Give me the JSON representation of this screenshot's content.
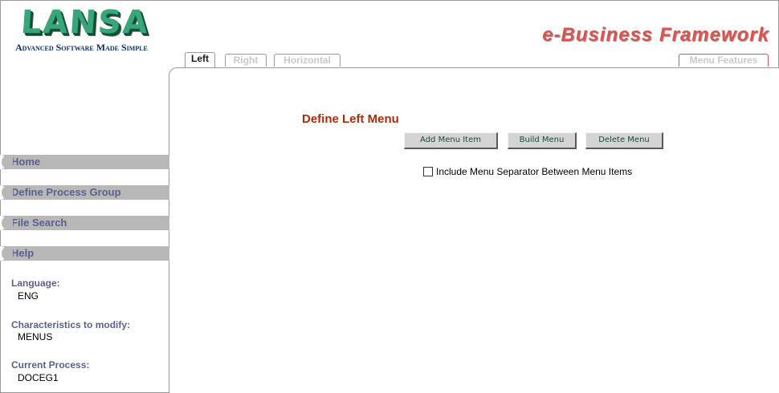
{
  "logo": {
    "word": "LANSA",
    "tagline": "Advanced Software Made Simple"
  },
  "brand": "e-Business Framework",
  "tabs": [
    {
      "label": "Left",
      "active": true
    },
    {
      "label": "Right",
      "active": false
    },
    {
      "label": "Horizontal",
      "active": false
    }
  ],
  "menu_features_label": "Menu Features",
  "sidebar": {
    "items": [
      {
        "label": "Home"
      },
      {
        "label": "Define Process Group"
      },
      {
        "label": "File Search"
      },
      {
        "label": "Help"
      }
    ],
    "info": {
      "language_label": "Language:",
      "language_value": "ENG",
      "characteristics_label": "Characteristics to modify:",
      "characteristics_value": "MENUS",
      "process_label": "Current Process:",
      "process_value": "DOCEG1"
    }
  },
  "main": {
    "title": "Define Left Menu",
    "buttons": {
      "add": "Add Menu Item",
      "build": "Build Menu",
      "delete": "Delete Menu"
    },
    "separator_checkbox_label": "Include Menu Separator Between Menu Items",
    "separator_checked": false
  },
  "colors": {
    "brand": "#d9534f",
    "title": "#b02a0c",
    "nav_bg": "#b8b8b8",
    "nav_text": "#5b5f8f",
    "logo_green": "#3aa57a"
  }
}
